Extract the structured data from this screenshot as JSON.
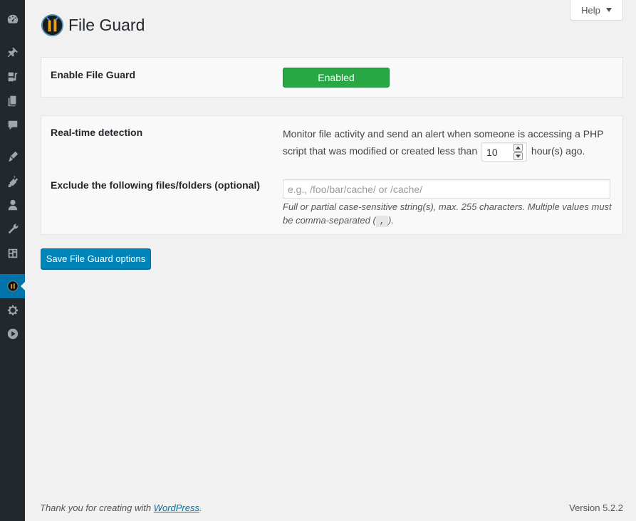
{
  "sidebar": {
    "items": [
      {
        "name": "dashboard-icon"
      },
      {
        "name": "pin-icon"
      },
      {
        "name": "media-icon"
      },
      {
        "name": "pages-icon"
      },
      {
        "name": "comments-icon"
      },
      {
        "name": "appearance-icon"
      },
      {
        "name": "plugins-icon"
      },
      {
        "name": "users-icon"
      },
      {
        "name": "tools-icon"
      },
      {
        "name": "plugin-extra-icon"
      },
      {
        "name": "file-guard-icon",
        "active": true
      },
      {
        "name": "settings-icon"
      },
      {
        "name": "media-play-icon"
      }
    ],
    "active_color": "#0073aa"
  },
  "help_tab": {
    "label": "Help"
  },
  "header": {
    "title": "File Guard"
  },
  "enable_section": {
    "label": "Enable File Guard",
    "toggle_label": "Enabled",
    "toggle_color": "#28a745"
  },
  "realtime": {
    "label": "Real-time detection",
    "desc_before": "Monitor file activity and send an alert when someone is accessing a PHP script that was modified or created less than",
    "hours_value": "10",
    "desc_after": "hour(s) ago."
  },
  "exclude": {
    "label": "Exclude the following files/folders (optional)",
    "placeholder": "e.g., /foo/bar/cache/ or /cache/",
    "value": "",
    "hint_before": "Full or partial case-sensitive string(s), max. 255 characters. Multiple values must be comma-separated (",
    "hint_code": ",",
    "hint_after": ")."
  },
  "save_button": {
    "label": "Save File Guard options",
    "color": "#0085ba"
  },
  "footer": {
    "thanks_before": "Thank you for creating with ",
    "thanks_link": "WordPress",
    "thanks_after": ".",
    "version": "Version 5.2.2"
  }
}
